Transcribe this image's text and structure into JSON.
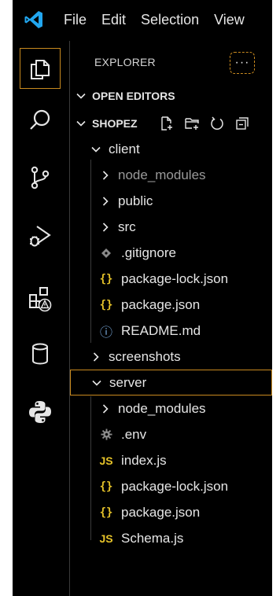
{
  "menu": [
    "File",
    "Edit",
    "Selection",
    "View"
  ],
  "activity_bar": [
    {
      "icon": "explorer-icon",
      "selected": true
    },
    {
      "icon": "search-icon",
      "selected": false
    },
    {
      "icon": "source-control-icon",
      "selected": false
    },
    {
      "icon": "run-debug-icon",
      "selected": false
    },
    {
      "icon": "extensions-warning-icon",
      "selected": false
    },
    {
      "icon": "database-icon",
      "selected": false
    },
    {
      "icon": "python-icon",
      "selected": false
    }
  ],
  "explorer": {
    "title": "EXPLORER",
    "more": "···",
    "open_editors": "OPEN EDITORS",
    "project": "SHOPEZ",
    "tree": [
      {
        "label": "client",
        "kind": "folder-open",
        "depth": 1
      },
      {
        "label": "node_modules",
        "kind": "folder",
        "depth": 2,
        "dim": true
      },
      {
        "label": "public",
        "kind": "folder",
        "depth": 2
      },
      {
        "label": "src",
        "kind": "folder",
        "depth": 2
      },
      {
        "label": ".gitignore",
        "kind": "git",
        "depth": 2
      },
      {
        "label": "package-lock.json",
        "kind": "json",
        "depth": 2
      },
      {
        "label": "package.json",
        "kind": "json",
        "depth": 2
      },
      {
        "label": "README.md",
        "kind": "info",
        "depth": 2
      },
      {
        "label": "screenshots",
        "kind": "folder",
        "depth": 1
      },
      {
        "label": "server",
        "kind": "folder-open",
        "depth": 1,
        "selected": true
      },
      {
        "label": "node_modules",
        "kind": "folder",
        "depth": 2
      },
      {
        "label": ".env",
        "kind": "gear",
        "depth": 2
      },
      {
        "label": "index.js",
        "kind": "js",
        "depth": 2
      },
      {
        "label": "package-lock.json",
        "kind": "json",
        "depth": 2
      },
      {
        "label": "package.json",
        "kind": "json",
        "depth": 2
      },
      {
        "label": "Schema.js",
        "kind": "js",
        "depth": 2
      }
    ]
  },
  "glyphs": {
    "json": "{}",
    "js": "JS",
    "info": "ⓘ"
  },
  "colors": {
    "selection_border": "#c98a1f",
    "json_icon": "#e5c229",
    "vscode_blue": "#22a7f0"
  }
}
